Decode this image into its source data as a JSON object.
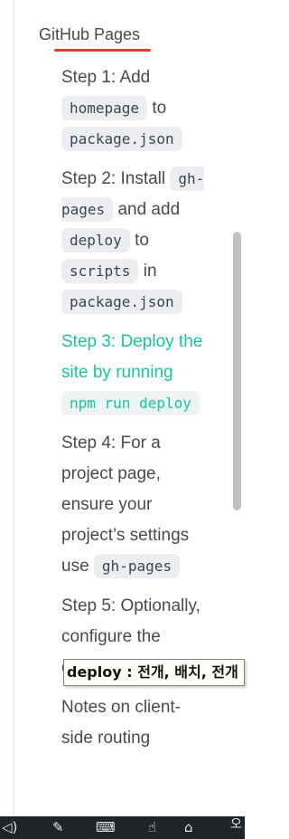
{
  "toc": {
    "section_title": "GitHub Pages",
    "items": [
      {
        "parts": [
          {
            "text": "Step 1: Add "
          },
          {
            "code": "homepage"
          },
          {
            "text": " to "
          },
          {
            "code": "package.json"
          }
        ],
        "active": false
      },
      {
        "parts": [
          {
            "text": "Step 2: Install "
          },
          {
            "code": "gh-pages"
          },
          {
            "text": " and add "
          },
          {
            "code": "deploy"
          },
          {
            "text": " to "
          },
          {
            "code": "scripts"
          },
          {
            "text": " in "
          },
          {
            "code": "package.json"
          }
        ],
        "active": false
      },
      {
        "parts": [
          {
            "text": "Step 3: Deploy the site by running "
          },
          {
            "code": "npm run deploy"
          }
        ],
        "active": true
      },
      {
        "parts": [
          {
            "text": "Step 4: For a project page, ensure your project’s settings use "
          },
          {
            "code": "gh-pages"
          }
        ],
        "active": false
      },
      {
        "parts": [
          {
            "text": "Step 5: Optionally, configure the domain"
          }
        ],
        "active": false
      },
      {
        "parts": [
          {
            "text": "Notes on client-side routing"
          }
        ],
        "active": false
      }
    ]
  },
  "tooltip": {
    "term": "deploy",
    "separator": " : ",
    "translation": "전개, 배치, 전개"
  },
  "taskbar": {
    "ime_indicator": "오"
  },
  "colors": {
    "accent": "#18c59a",
    "underline": "#e53935",
    "code_background": "#eceef1"
  }
}
